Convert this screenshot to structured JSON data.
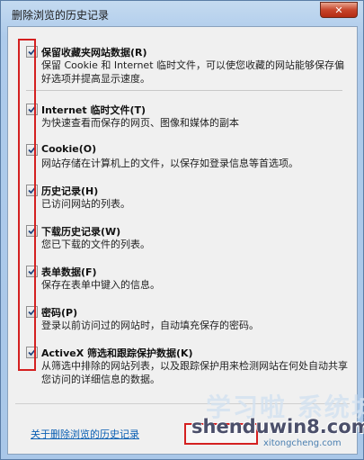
{
  "window": {
    "title": "删除浏览的历史记录",
    "close_glyph": "✕"
  },
  "items": [
    {
      "title": "保留收藏夹网站数据(R)",
      "description": "保留 Cookie 和 Internet 临时文件，可以使您收藏的网站能够保存偏好选项并提高显示速度。",
      "checked": true
    },
    {
      "title": "Internet 临时文件(T)",
      "description": "为快速查看而保存的网页、图像和媒体的副本",
      "checked": true
    },
    {
      "title": "Cookie(O)",
      "description": "网站存储在计算机上的文件，以保存如登录信息等首选项。",
      "checked": true
    },
    {
      "title": "历史记录(H)",
      "description": "已访问网站的列表。",
      "checked": true
    },
    {
      "title": "下载历史记录(W)",
      "description": "您已下载的文件的列表。",
      "checked": true
    },
    {
      "title": "表单数据(F)",
      "description": "保存在表单中键入的信息。",
      "checked": true
    },
    {
      "title": "密码(P)",
      "description": "登录以前访问过的网站时，自动填充保存的密码。",
      "checked": true
    },
    {
      "title": "ActiveX 筛选和跟踪保护数据(K)",
      "description": "从筛选中排除的网站列表，以及跟踪保护用来检测网站在何处自动共享您访问的详细信息的数据。",
      "checked": true
    }
  ],
  "footer": {
    "about_link": "关于删除浏览的历史记录"
  },
  "watermark": {
    "main": "shenduwin8.com",
    "sub": "xitongcheng.com",
    "ghost": "学习啦 系统城"
  },
  "colors": {
    "highlight": "#d42020",
    "link": "#0b5fb3"
  }
}
